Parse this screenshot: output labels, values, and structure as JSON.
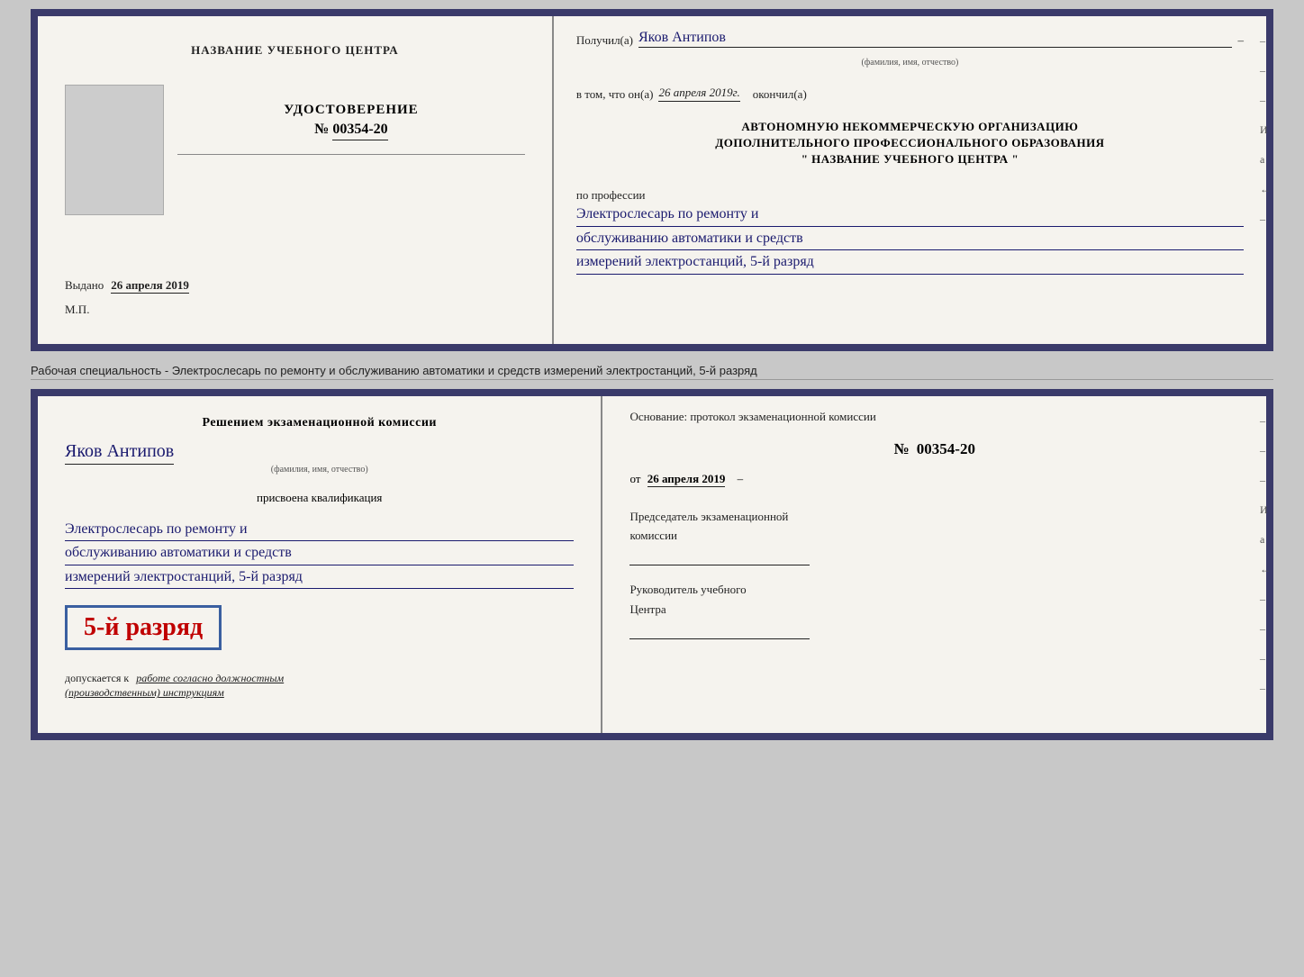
{
  "top_cert": {
    "left": {
      "org_name": "НАЗВАНИЕ УЧЕБНОГО ЦЕНТРА",
      "udostoverenie": "УДОСТОВЕРЕНИЕ",
      "number_label": "№",
      "number_value": "00354-20",
      "vydano_label": "Выдано",
      "vydano_date": "26 апреля 2019",
      "mp": "М.П."
    },
    "right": {
      "poluchil_label": "Получил(а)",
      "poluchil_name": "Яков Антипов",
      "fio_subtitle": "(фамилия, имя, отчество)",
      "vtom_label": "в том, что он(а)",
      "vtom_date": "26 апреля 2019г.",
      "okronchill_label": "окончил(а)",
      "org_line1": "АВТОНОМНУЮ НЕКОММЕРЧЕСКУЮ ОРГАНИЗАЦИЮ",
      "org_line2": "ДОПОЛНИТЕЛЬНОГО ПРОФЕССИОНАЛЬНОГО ОБРАЗОВАНИЯ",
      "org_quote_open": "\"",
      "org_center_name": "НАЗВАНИЕ УЧЕБНОГО ЦЕНТРА",
      "org_quote_close": "\"",
      "po_professii": "по профессии",
      "profession_line1": "Электрослесарь по ремонту и",
      "profession_line2": "обслуживанию автоматики и средств",
      "profession_line3": "измерений электростанций, 5-й разряд"
    }
  },
  "subtitle": {
    "text": "Рабочая специальность - Электрослесарь по ремонту и обслуживанию автоматики и средств измерений электростанций, 5-й разряд"
  },
  "bottom_cert": {
    "left": {
      "resheniem_label": "Решением экзаменационной комиссии",
      "name_value": "Яков Антипов",
      "fio_subtitle": "(фамилия, имя, отчество)",
      "prisvoena_label": "присвоена квалификация",
      "qual_line1": "Электрослесарь по ремонту и",
      "qual_line2": "обслуживанию автоматики и средств",
      "qual_line3": "измерений электростанций, 5-й разряд",
      "grade_text": "5-й разряд",
      "dopuskaetsya": "допускается к",
      "dopuskaetsya_value": "работе согласно должностным",
      "instruktsii_value": "(производственным) инструкциям"
    },
    "right": {
      "osnovanie": "Основание: протокол экзаменационной комиссии",
      "number_label": "№",
      "number_value": "00354-20",
      "ot_label": "от",
      "ot_date": "26 апреля 2019",
      "predsedatel_line1": "Председатель экзаменационной",
      "predsedatel_line2": "комиссии",
      "rukovoditel_line1": "Руководитель учебного",
      "rukovoditel_line2": "Центра"
    }
  },
  "dashes": {
    "marks": [
      "–",
      "–",
      "–",
      "И",
      "а",
      "←",
      "–",
      "–",
      "–",
      "–"
    ]
  }
}
